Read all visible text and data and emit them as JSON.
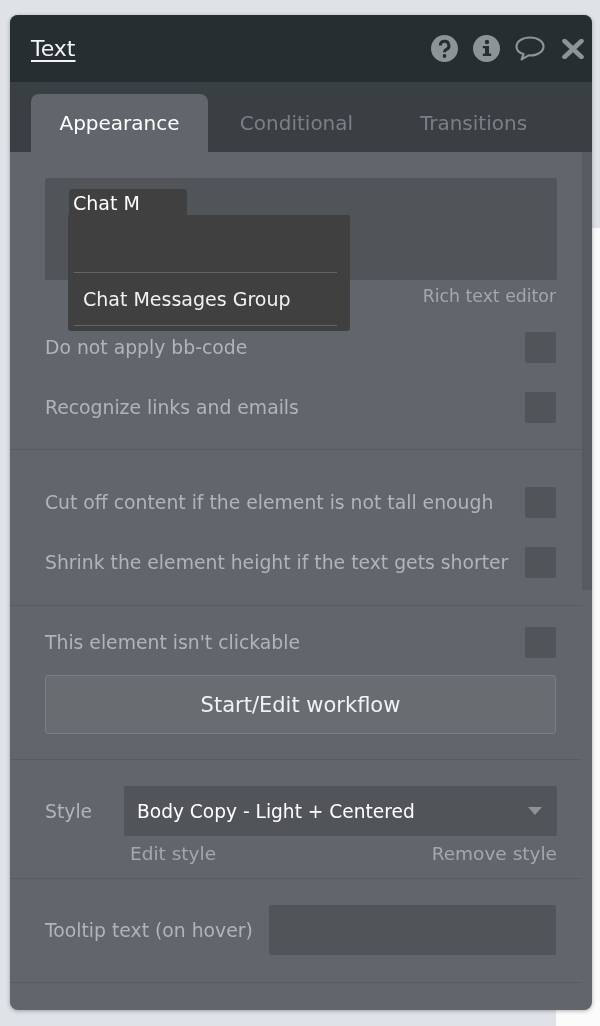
{
  "window": {
    "title": "Text"
  },
  "tabs": [
    {
      "label": "Appearance",
      "selected": true
    },
    {
      "label": "Conditional",
      "selected": false
    },
    {
      "label": "Transitions",
      "selected": false
    }
  ],
  "text_editor": {
    "autocomplete": {
      "query": "Chat M",
      "options": [
        {
          "label": "Chat Messages Group",
          "selected": false
        }
      ]
    },
    "link": "Rich text editor"
  },
  "text_options": [
    {
      "label": "Do not apply bb-code",
      "checked": false
    },
    {
      "label": "Recognize links and emails",
      "checked": false
    }
  ],
  "size_options": [
    {
      "label": "Cut off content if the element is not tall enough",
      "checked": false
    },
    {
      "label": "Shrink the element height if the text gets shorter",
      "checked": false
    }
  ],
  "click_options": [
    {
      "label": "This element isn't clickable",
      "checked": false
    }
  ],
  "workflow_button": {
    "label": "Start/Edit workflow"
  },
  "style": {
    "label": "Style",
    "value": "Body Copy - Light + Centered",
    "links": [
      "Edit style",
      "Remove style"
    ]
  },
  "tooltip": {
    "label": "Tooltip text (on hover)"
  }
}
